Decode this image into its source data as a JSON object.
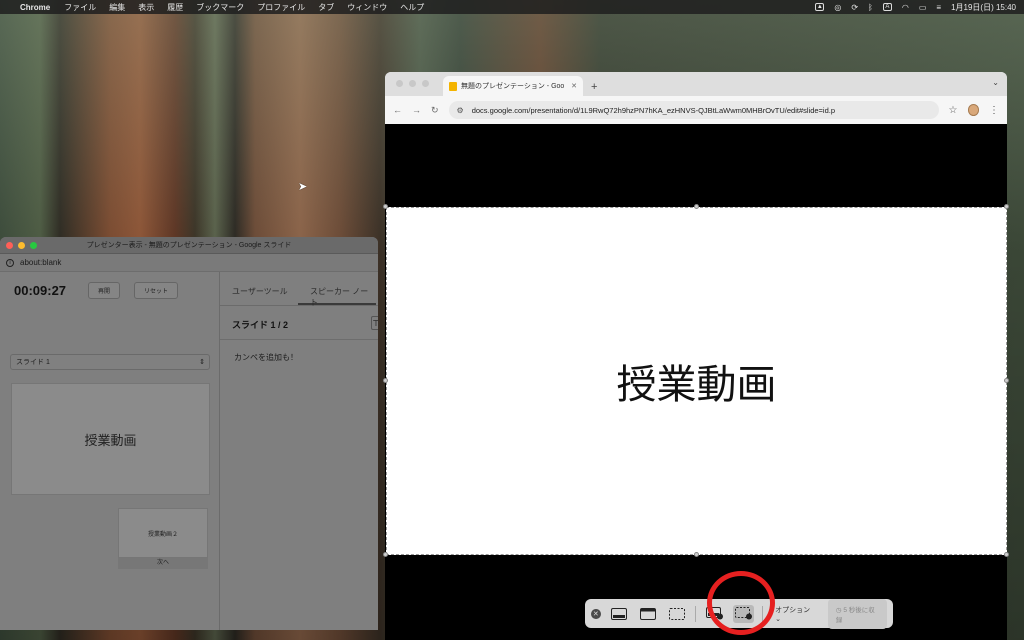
{
  "menubar": {
    "app": "Chrome",
    "items": [
      "ファイル",
      "編集",
      "表示",
      "履歴",
      "ブックマーク",
      "プロファイル",
      "タブ",
      "ウィンドウ",
      "ヘルプ"
    ],
    "clock": "1月19日(日)  15:40"
  },
  "presenter": {
    "title": "プレゼンター表示 - 無題のプレゼンテーション - Google スライド",
    "url": "about:blank",
    "timer": "00:09:27",
    "resume_label": "再開",
    "reset_label": "リセット",
    "slide_select": "スライド 1",
    "current_slide_text": "授業動画",
    "next_slide_text": "授業動画２",
    "next_label": "次へ",
    "tabs": [
      "ユーザーツール",
      "スピーカー ノート"
    ],
    "slide_count": "スライド 1 / 2",
    "notes": "カンペを追加も！"
  },
  "chrome": {
    "tab_title": "無題のプレゼンテーション - Goo",
    "new_tab": "+",
    "url": "docs.google.com/presentation/d/1L9RwQ72h9hzPN7hKA_ezHNVS-QJBtLaWwm0MHBrOvTU/edit#slide=id.p"
  },
  "slide": {
    "title": "授業動画"
  },
  "screenshot_toolbar": {
    "options_label": "オプション ⌄",
    "timer_label": "◷ 5 秒後に収録"
  },
  "colors": {
    "annotation_circle": "#e62020",
    "traffic_red": "#ff5f57",
    "traffic_yellow": "#febc2e",
    "traffic_green": "#28c840"
  }
}
